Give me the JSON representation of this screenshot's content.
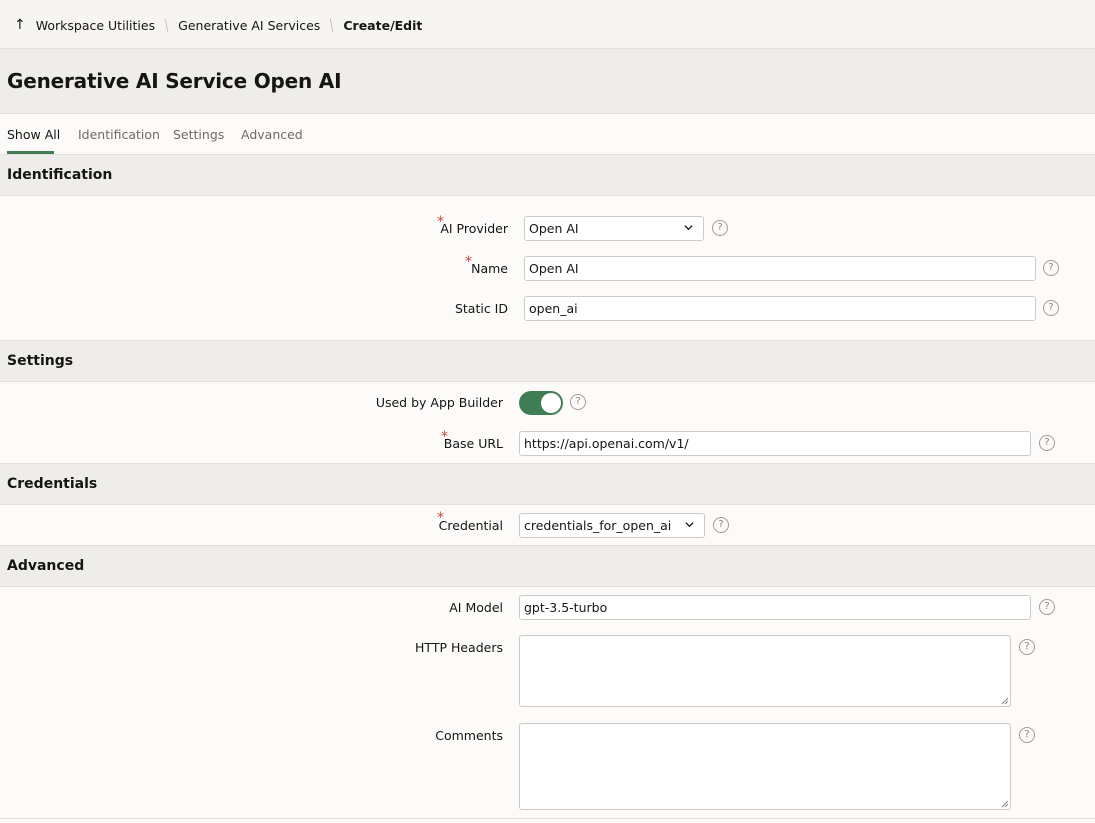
{
  "breadcrumb": {
    "items": [
      "Workspace Utilities",
      "Generative AI Services"
    ],
    "current": "Create/Edit"
  },
  "page": {
    "title": "Generative AI Service Open AI"
  },
  "tabs": [
    "Show All",
    "Identification",
    "Settings",
    "Advanced"
  ],
  "sections": {
    "identification": "Identification",
    "settings": "Settings",
    "credentials": "Credentials",
    "advanced": "Advanced"
  },
  "fields": {
    "ai_provider": {
      "label": "AI Provider",
      "value": "Open AI",
      "required": true
    },
    "name": {
      "label": "Name",
      "value": "Open AI",
      "required": true
    },
    "static_id": {
      "label": "Static ID",
      "value": "open_ai"
    },
    "used_by_app_builder": {
      "label": "Used by App Builder",
      "value": true
    },
    "base_url": {
      "label": "Base URL",
      "value": "https://api.openai.com/v1/",
      "required": true
    },
    "credential": {
      "label": "Credential",
      "value": "credentials_for_open_ai",
      "required": true
    },
    "ai_model": {
      "label": "AI Model",
      "value": "gpt-3.5-turbo"
    },
    "http_headers": {
      "label": "HTTP Headers",
      "value": ""
    },
    "comments": {
      "label": "Comments",
      "value": ""
    }
  },
  "colors": {
    "accent": "#3f7e55",
    "required": "#c74634"
  },
  "icons": {
    "up": "arrow-up-icon",
    "help": "help-icon",
    "dropdown": "chevron-down-icon"
  }
}
